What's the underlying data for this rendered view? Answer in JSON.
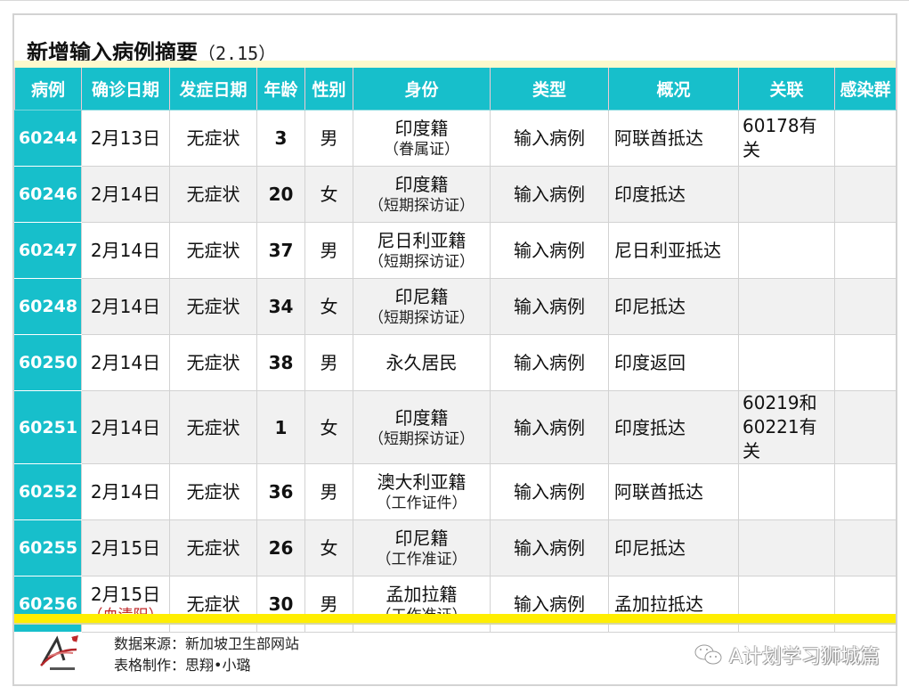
{
  "title": {
    "main": "新增输入病例摘要",
    "date": "（2.15）"
  },
  "table": {
    "headers": [
      "病例",
      "确诊日期",
      "发症日期",
      "年龄",
      "性别",
      "身份",
      "类型",
      "概况",
      "关联",
      "感染群"
    ],
    "rows": [
      {
        "case": "60244",
        "confirm_date": "2月13日",
        "confirm_note": "",
        "onset": "无症状",
        "age": "3",
        "sex": "男",
        "identity": "印度籍",
        "identity_note": "（眷属证）",
        "type": "输入病例",
        "summary": "阿联酋抵达",
        "link": "60178有关",
        "cluster": ""
      },
      {
        "case": "60246",
        "confirm_date": "2月14日",
        "confirm_note": "",
        "onset": "无症状",
        "age": "20",
        "sex": "女",
        "identity": "印度籍",
        "identity_note": "（短期探访证）",
        "type": "输入病例",
        "summary": "印度抵达",
        "link": "",
        "cluster": ""
      },
      {
        "case": "60247",
        "confirm_date": "2月14日",
        "confirm_note": "",
        "onset": "无症状",
        "age": "37",
        "sex": "男",
        "identity": "尼日利亚籍",
        "identity_note": "（短期探访证）",
        "type": "输入病例",
        "summary": "尼日利亚抵达",
        "link": "",
        "cluster": ""
      },
      {
        "case": "60248",
        "confirm_date": "2月14日",
        "confirm_note": "",
        "onset": "无症状",
        "age": "34",
        "sex": "女",
        "identity": "印尼籍",
        "identity_note": "（短期探访证）",
        "type": "输入病例",
        "summary": "印尼抵达",
        "link": "",
        "cluster": ""
      },
      {
        "case": "60250",
        "confirm_date": "2月14日",
        "confirm_note": "",
        "onset": "无症状",
        "age": "38",
        "sex": "男",
        "identity": "永久居民",
        "identity_note": "",
        "type": "输入病例",
        "summary": "印度返回",
        "link": "",
        "cluster": ""
      },
      {
        "case": "60251",
        "confirm_date": "2月14日",
        "confirm_note": "",
        "onset": "无症状",
        "age": "1",
        "sex": "女",
        "identity": "印度籍",
        "identity_note": "（短期探访证）",
        "type": "输入病例",
        "summary": "印度抵达",
        "link": "60219和 60221有关",
        "cluster": ""
      },
      {
        "case": "60252",
        "confirm_date": "2月14日",
        "confirm_note": "",
        "onset": "无症状",
        "age": "36",
        "sex": "男",
        "identity": "澳大利亚籍",
        "identity_note": "（工作证件）",
        "type": "输入病例",
        "summary": "阿联酋抵达",
        "link": "",
        "cluster": ""
      },
      {
        "case": "60255",
        "confirm_date": "2月15日",
        "confirm_note": "",
        "onset": "无症状",
        "age": "26",
        "sex": "女",
        "identity": "印尼籍",
        "identity_note": "（工作准证）",
        "type": "输入病例",
        "summary": "印尼抵达",
        "link": "",
        "cluster": ""
      },
      {
        "case": "60256",
        "confirm_date": "2月15日",
        "confirm_note": "（血清阳）",
        "onset": "无症状",
        "age": "30",
        "sex": "男",
        "identity": "孟加拉籍",
        "identity_note": "（工作准证）",
        "type": "输入病例",
        "summary": "孟加拉抵达",
        "link": "",
        "cluster": ""
      }
    ]
  },
  "footer": {
    "source": "数据来源：新加坡卫生部网站",
    "maker": "表格制作：思翔•小璐",
    "logo_icon": "a-plan-logo-icon",
    "watermark_icon": "wechat-icon",
    "watermark": "A计划学习狮城篇"
  },
  "colors": {
    "header_bg": "#17bfcb",
    "accent_yellow": "#ffee00",
    "pale_yellow": "#fdf9cc",
    "note_red": "#c0282a"
  }
}
